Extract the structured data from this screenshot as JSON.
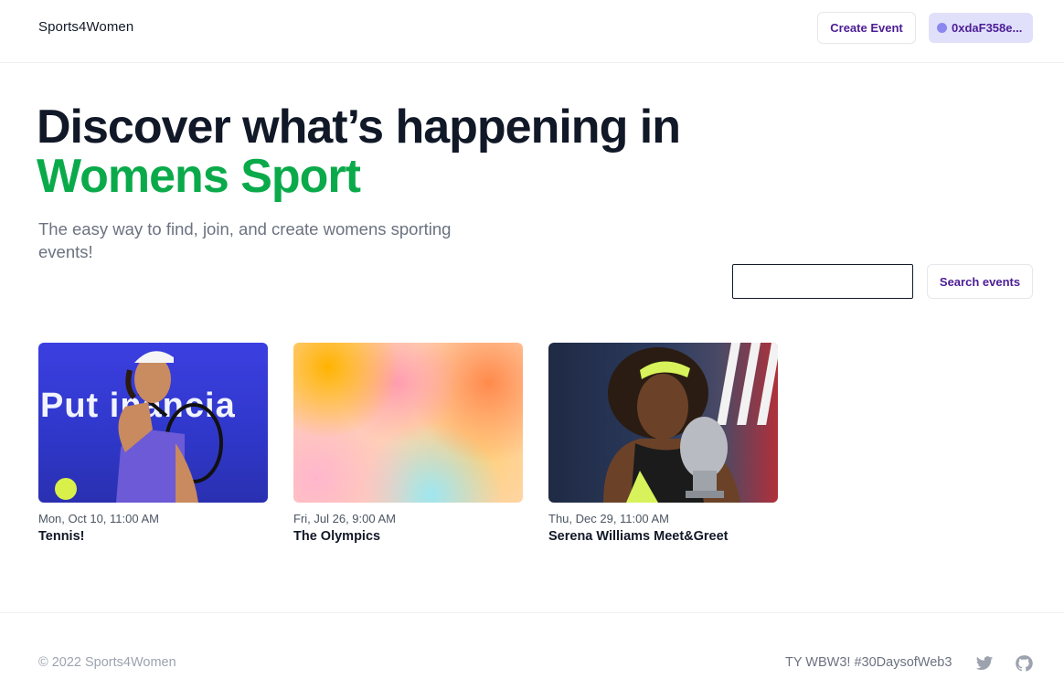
{
  "header": {
    "brand": "Sports4Women",
    "create_event_label": "Create Event",
    "wallet_label": "0xdaF358e..."
  },
  "hero": {
    "title_line1": "Discover what’s happening in",
    "title_line2": "Womens Sport",
    "subtitle": "The easy way to find, join, and create womens sporting events!"
  },
  "search": {
    "input_value": "",
    "button_label": "Search events"
  },
  "events": [
    {
      "date": "Mon, Oct 10, 11:00 AM",
      "title": "Tennis!",
      "image": "tennis-player-photo",
      "banner_text": "Put   inancia"
    },
    {
      "date": "Fri, Jul 26, 9:00 AM",
      "title": "The Olympics",
      "image": "gradient-placeholder"
    },
    {
      "date": "Thu, Dec 29, 11:00 AM",
      "title": "Serena Williams Meet&Greet",
      "image": "trophy-photo"
    }
  ],
  "footer": {
    "copyright": "© 2022 Sports4Women",
    "note": "TY WBW3! #30DaysofWeb3",
    "icons": [
      "twitter-icon",
      "github-icon"
    ]
  },
  "colors": {
    "accent_green": "#0aaa4a",
    "button_text": "#4c1d95",
    "wallet_bg": "#e0e0fb",
    "wallet_dot": "#8b87ee"
  }
}
